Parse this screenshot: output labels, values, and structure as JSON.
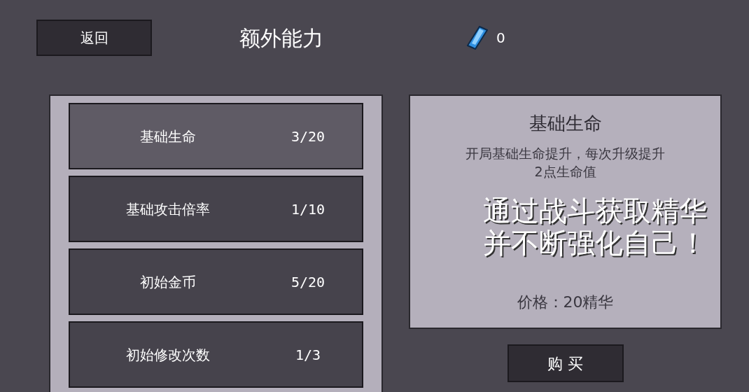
{
  "header": {
    "back_button": "返回",
    "title": "额外能力",
    "currency": "0"
  },
  "abilities": [
    {
      "name": "基础生命",
      "progress": "3/20",
      "selected": true
    },
    {
      "name": "基础攻击倍率",
      "progress": "1/10",
      "selected": false
    },
    {
      "name": "初始金币",
      "progress": "5/20",
      "selected": false
    },
    {
      "name": "初始修改次数",
      "progress": "1/3",
      "selected": false
    }
  ],
  "detail": {
    "title": "基础生命",
    "description": "开局基础生命提升，每次升级提升",
    "description_2": "2点生命值",
    "price": "价格：20精华"
  },
  "buy_button": "购 买",
  "caption": [
    "通过战斗获取精华",
    "并不断强化自己！"
  ]
}
